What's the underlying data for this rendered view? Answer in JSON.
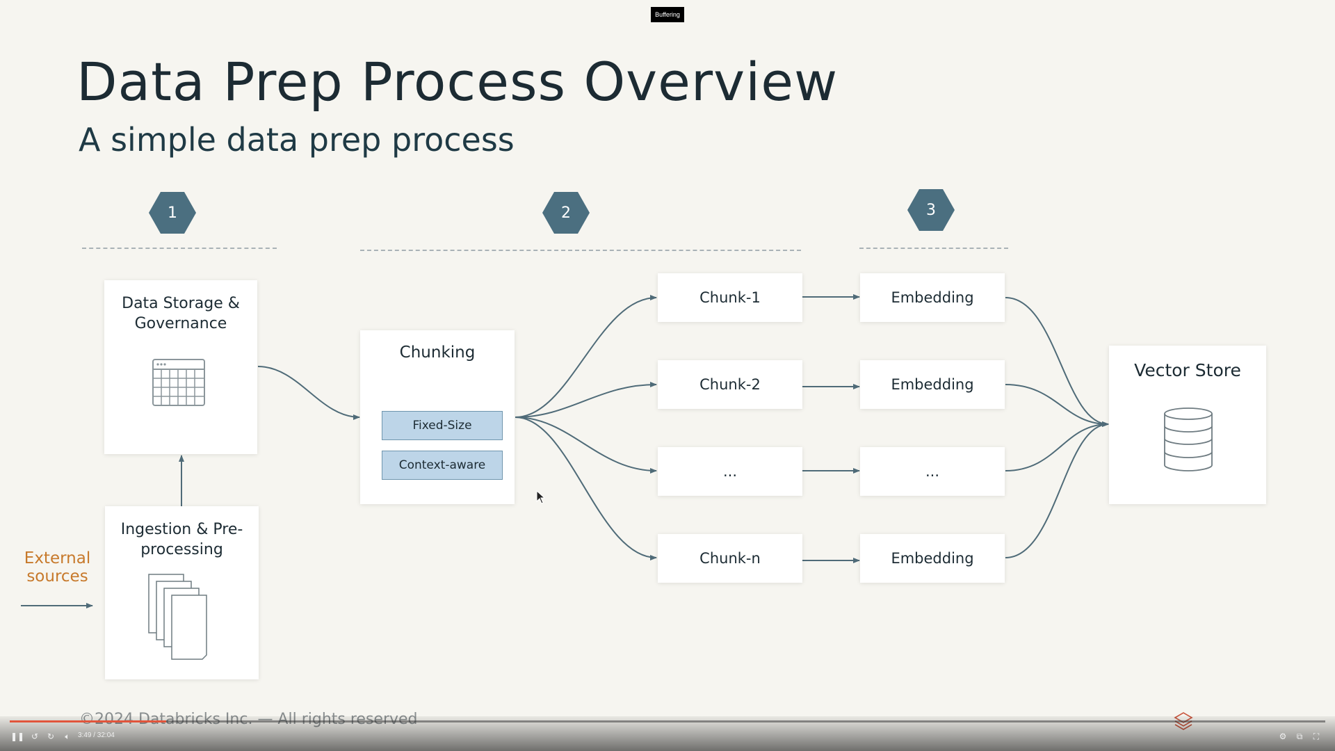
{
  "player": {
    "status": "Buffering",
    "time": "3:49 / 32:04",
    "progress_fraction": 0.119
  },
  "slide": {
    "title": "Data Prep Process Overview",
    "subtitle": "A simple data prep process",
    "steps": [
      "1",
      "2",
      "3"
    ],
    "external_sources": "External sources",
    "storage": "Data Storage & Governance",
    "ingestion": "Ingestion & Pre-processing",
    "chunking": {
      "title": "Chunking",
      "options": [
        "Fixed-Size",
        "Context-aware"
      ]
    },
    "chunks": [
      "Chunk-1",
      "Chunk-2",
      "...",
      "Chunk-n"
    ],
    "embeddings": [
      "Embedding",
      "Embedding",
      "...",
      "Embedding"
    ],
    "vector_store": "Vector Store",
    "footer": "©2024 Databricks Inc. — All rights reserved"
  },
  "colors": {
    "background": "#f6f5f0",
    "hexagon": "#4b6f80",
    "accent_orange": "#c7792b",
    "chip_fill": "#bdd5e8",
    "arrow": "#4f6b78",
    "progress": "#e1553c"
  },
  "icons": [
    "table-icon",
    "documents-icon",
    "database-icon",
    "databricks-logo-icon",
    "pause-icon",
    "rewind-icon",
    "forward-icon",
    "volume-icon",
    "settings-icon",
    "popout-icon",
    "fullscreen-icon",
    "mouse-cursor-icon"
  ]
}
